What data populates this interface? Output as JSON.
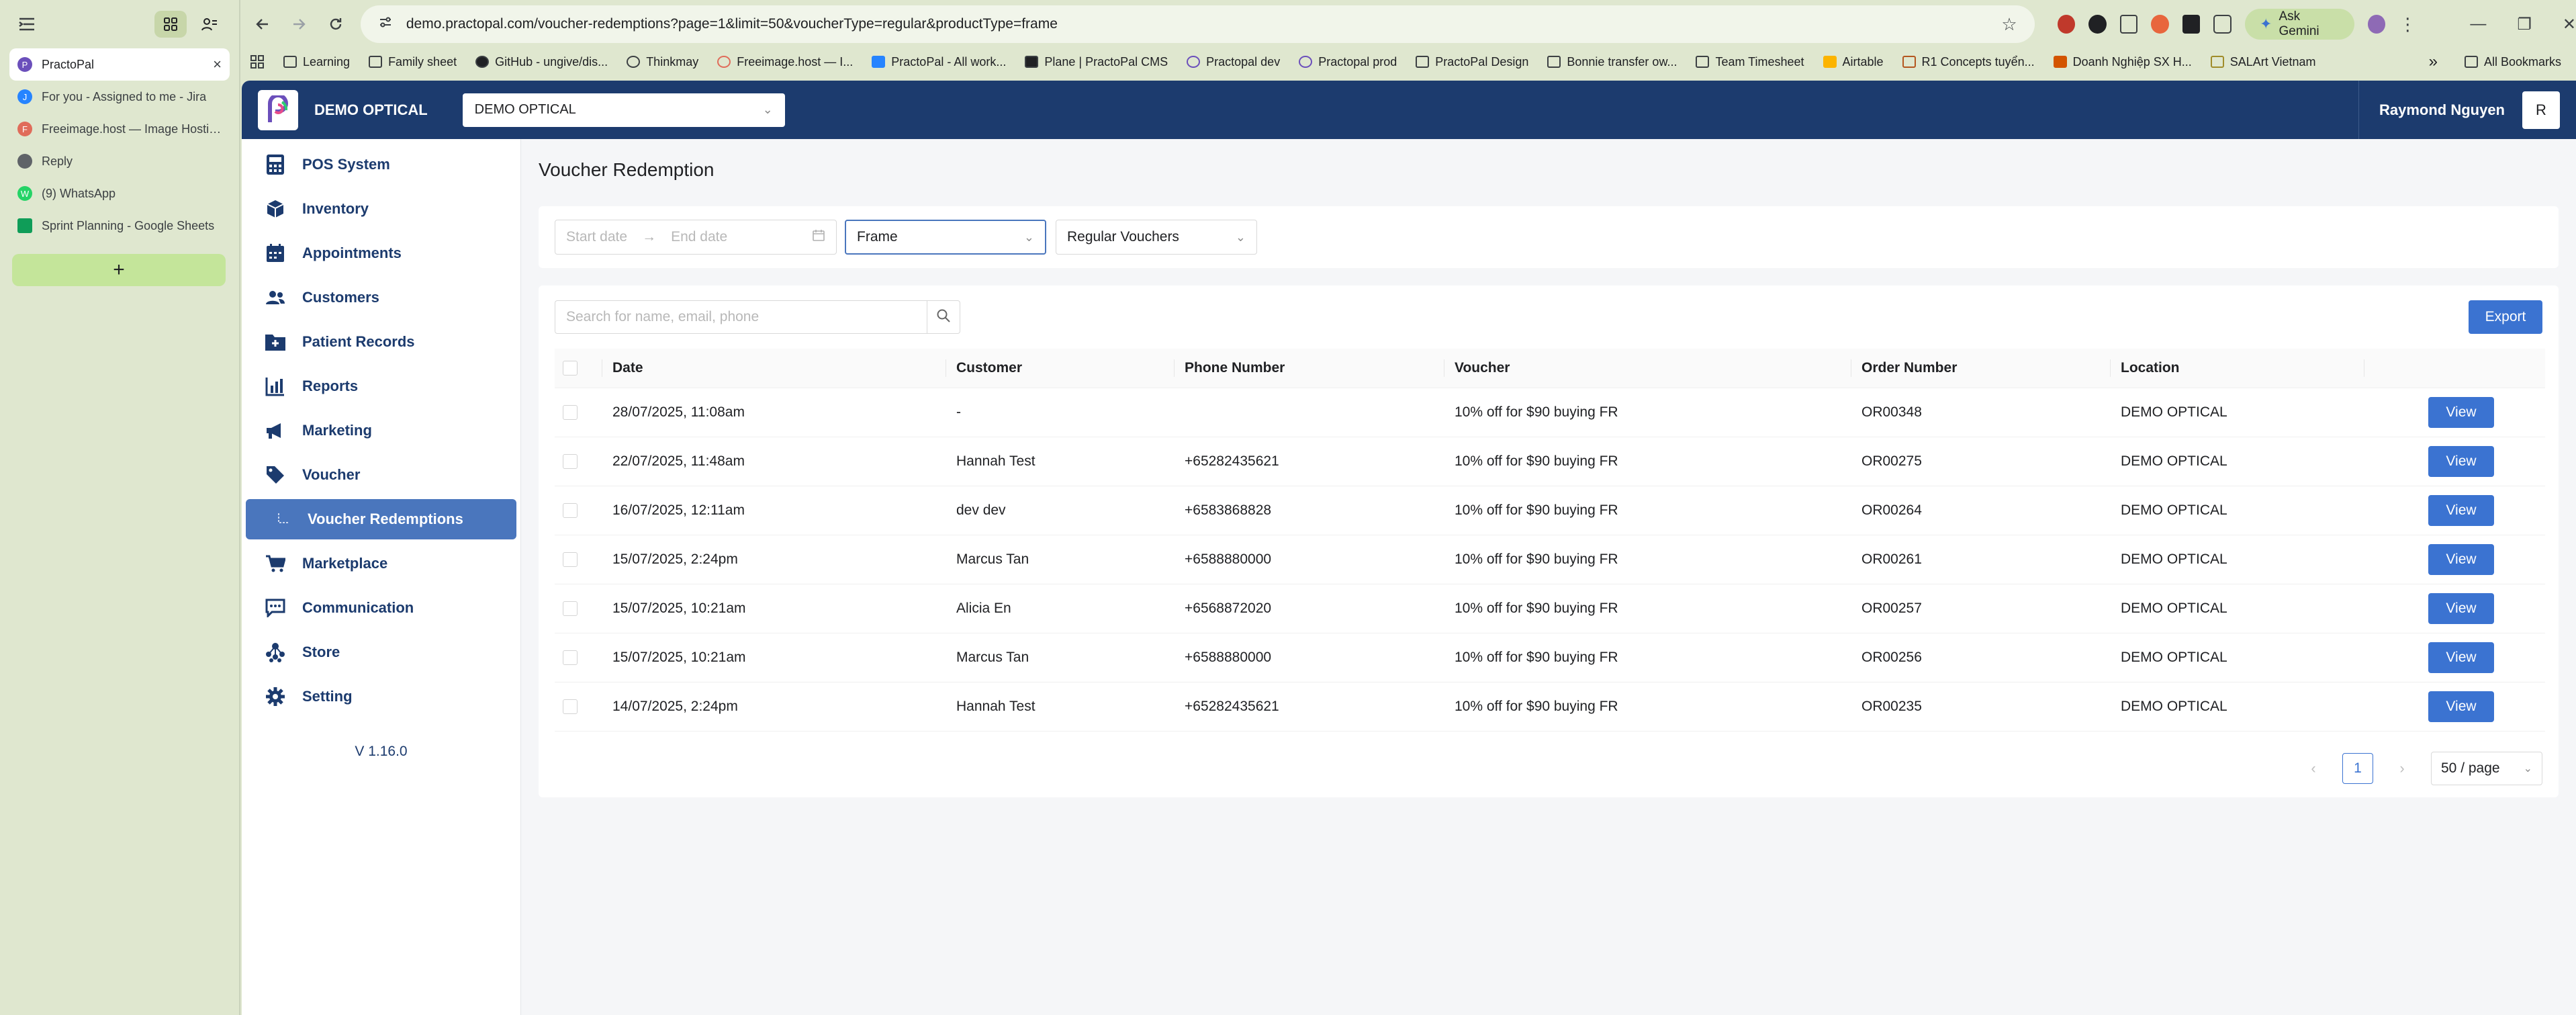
{
  "browser": {
    "url": "demo.practopal.com/voucher-redemptions?page=1&limit=50&voucherType=regular&productType=frame",
    "ask_gemini": "Ask Gemini",
    "tabs": [
      {
        "title": "PractoPal",
        "color": "#6b4fbb"
      },
      {
        "title": "For you - Assigned to me - Jira",
        "color": "#2684ff"
      },
      {
        "title": "Freeimage.host — Image Hosting",
        "color": "#e06c5a"
      },
      {
        "title": "Reply",
        "color": "#5f6368"
      },
      {
        "title": "(9) WhatsApp",
        "color": "#25d366"
      },
      {
        "title": "Sprint Planning - Google Sheets",
        "color": "#0f9d58"
      }
    ],
    "new_tab": "+",
    "bookmarks": [
      {
        "label": "Learning",
        "icon": "folder-icon"
      },
      {
        "label": "Family sheet",
        "icon": "folder-icon"
      },
      {
        "label": "GitHub - ungive/dis...",
        "icon": "github-icon"
      },
      {
        "label": "Thinkmay",
        "icon": "site-icon"
      },
      {
        "label": "Freeimage.host — I...",
        "icon": "site-icon"
      },
      {
        "label": "PractoPal - All work...",
        "icon": "site-icon"
      },
      {
        "label": "Plane | PractoPal CMS",
        "icon": "site-icon"
      },
      {
        "label": "Practopal dev",
        "icon": "site-icon"
      },
      {
        "label": "Practopal prod",
        "icon": "site-icon"
      },
      {
        "label": "PractoPal Design",
        "icon": "folder-icon"
      },
      {
        "label": "Bonnie transfer ow...",
        "icon": "folder-icon"
      },
      {
        "label": "Team Timesheet",
        "icon": "folder-icon"
      },
      {
        "label": "Airtable",
        "icon": "site-icon"
      },
      {
        "label": "R1 Concepts tuyển...",
        "icon": "site-icon"
      },
      {
        "label": "Doanh Nghiệp SX H...",
        "icon": "site-icon"
      },
      {
        "label": "SALArt Vietnam",
        "icon": "folder-icon"
      }
    ],
    "more_bookmarks": "»",
    "all_bookmarks": "All Bookmarks"
  },
  "header": {
    "org_name": "DEMO OPTICAL",
    "org_select": "DEMO OPTICAL",
    "user_name": "Raymond Nguyen",
    "avatar_initial": "R"
  },
  "sidebar": {
    "items": [
      {
        "label": "POS System",
        "icon": "calculator-icon"
      },
      {
        "label": "Inventory",
        "icon": "box-icon"
      },
      {
        "label": "Appointments",
        "icon": "calendar-icon"
      },
      {
        "label": "Customers",
        "icon": "users-icon"
      },
      {
        "label": "Patient Records",
        "icon": "folder-plus-icon"
      },
      {
        "label": "Reports",
        "icon": "bar-chart-icon"
      },
      {
        "label": "Marketing",
        "icon": "megaphone-icon"
      },
      {
        "label": "Voucher",
        "icon": "tag-icon"
      },
      {
        "label": "Voucher Redemptions",
        "icon": "sub-branch-icon"
      },
      {
        "label": "Marketplace",
        "icon": "cart-icon"
      },
      {
        "label": "Communication",
        "icon": "chat-icon"
      },
      {
        "label": "Store",
        "icon": "sitemap-icon"
      },
      {
        "label": "Setting",
        "icon": "gear-icon"
      }
    ],
    "version": "V 1.16.0"
  },
  "page": {
    "title": "Voucher Redemption",
    "filters": {
      "start_placeholder": "Start date",
      "end_placeholder": "End date",
      "product_type": "Frame",
      "voucher_type": "Regular Vouchers"
    },
    "search_placeholder": "Search for name, email, phone",
    "export_label": "Export",
    "columns": [
      "Date",
      "Customer",
      "Phone Number",
      "Voucher",
      "Order Number",
      "Location"
    ],
    "view_label": "View",
    "rows": [
      {
        "date": "28/07/2025, 11:08am",
        "customer": "-",
        "phone": "",
        "voucher": "10% off for $90 buying FR",
        "order": "OR00348",
        "location": "DEMO OPTICAL"
      },
      {
        "date": "22/07/2025, 11:48am",
        "customer": "Hannah Test",
        "phone": "+65282435621",
        "voucher": "10% off for $90 buying FR",
        "order": "OR00275",
        "location": "DEMO OPTICAL"
      },
      {
        "date": "16/07/2025, 12:11am",
        "customer": "dev dev",
        "phone": "+6583868828",
        "voucher": "10% off for $90 buying FR",
        "order": "OR00264",
        "location": "DEMO OPTICAL"
      },
      {
        "date": "15/07/2025, 2:24pm",
        "customer": "Marcus Tan",
        "phone": "+6588880000",
        "voucher": "10% off for $90 buying FR",
        "order": "OR00261",
        "location": "DEMO OPTICAL"
      },
      {
        "date": "15/07/2025, 10:21am",
        "customer": "Alicia En",
        "phone": "+6568872020",
        "voucher": "10% off for $90 buying FR",
        "order": "OR00257",
        "location": "DEMO OPTICAL"
      },
      {
        "date": "15/07/2025, 10:21am",
        "customer": "Marcus Tan",
        "phone": "+6588880000",
        "voucher": "10% off for $90 buying FR",
        "order": "OR00256",
        "location": "DEMO OPTICAL"
      },
      {
        "date": "14/07/2025, 2:24pm",
        "customer": "Hannah Test",
        "phone": "+65282435621",
        "voucher": "10% off for $90 buying FR",
        "order": "OR00235",
        "location": "DEMO OPTICAL"
      }
    ],
    "pagination": {
      "prev": "‹",
      "current": "1",
      "next": "›",
      "page_size": "50 / page"
    }
  },
  "colors": {
    "header_bg": "#1c3b6e",
    "accent": "#3b73d1",
    "active_sidebar": "#4a76bd"
  }
}
